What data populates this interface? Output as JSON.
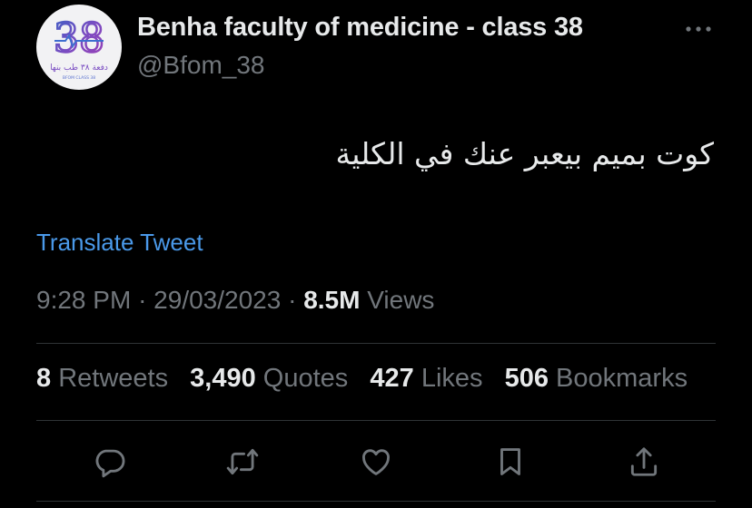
{
  "profile": {
    "display_name": "Benha faculty of medicine - class 38",
    "handle": "@Bfom_38",
    "avatar_number": "38",
    "avatar_arabic": "دفعة ٣٨ طب بنها",
    "avatar_caption": "BFOM CLASS 38"
  },
  "tweet": {
    "text": "كوت بميم بيعبر عنك في الكلية",
    "translate_label": "Translate Tweet",
    "time": "9:28 PM",
    "date": "29/03/2023",
    "views_count": "8.5M",
    "views_label": "Views",
    "separator": "·"
  },
  "stats": {
    "retweets": {
      "count": "8",
      "label": "Retweets"
    },
    "quotes": {
      "count": "3,490",
      "label": "Quotes"
    },
    "likes": {
      "count": "427",
      "label": "Likes"
    },
    "bookmarks": {
      "count": "506",
      "label": "Bookmarks"
    }
  },
  "actions": [
    "reply-icon",
    "retweet-icon",
    "like-icon",
    "bookmark-icon",
    "share-icon"
  ],
  "colors": {
    "background": "#000000",
    "text_primary": "#e7e9ea",
    "text_secondary": "#71767b",
    "link": "#4a99e9",
    "divider": "#2f3336"
  }
}
